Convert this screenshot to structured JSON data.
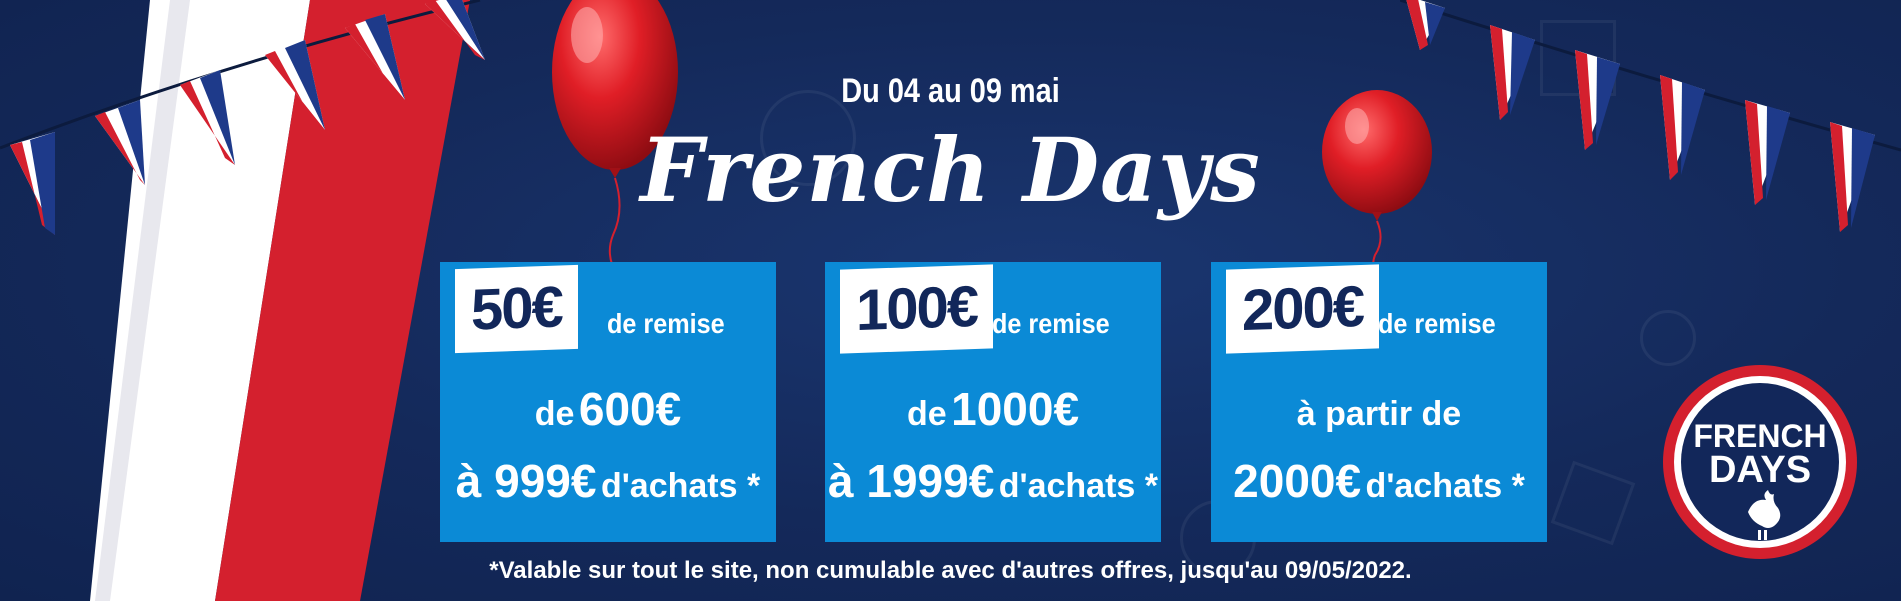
{
  "date_line": "Du 04 au 09 mai",
  "title": "French Days",
  "offers": [
    {
      "amount": "50€",
      "remise_label": "de remise",
      "line1_small": "de",
      "line1_big": "600€",
      "line2_big": "à 999€",
      "line2_small": "d'achats *"
    },
    {
      "amount": "100€",
      "remise_label": "de remise",
      "line1_small": "de",
      "line1_big": "1000€",
      "line2_big": "à 1999€",
      "line2_small": "d'achats *"
    },
    {
      "amount": "200€",
      "remise_label": "de remise",
      "line1_small": "à partir de",
      "line1_big": "",
      "line2_big": "2000€",
      "line2_small": "d'achats *"
    }
  ],
  "footnote": "*Valable sur tout le site, non cumulable avec d'autres offres, jusqu'au 09/05/2022.",
  "badge": {
    "line1": "FRENCH",
    "line2": "DAYS"
  },
  "colors": {
    "background": "#132a5a",
    "card": "#0b8ad6",
    "red": "#d4202e",
    "white": "#ffffff",
    "navy": "#12275a"
  }
}
